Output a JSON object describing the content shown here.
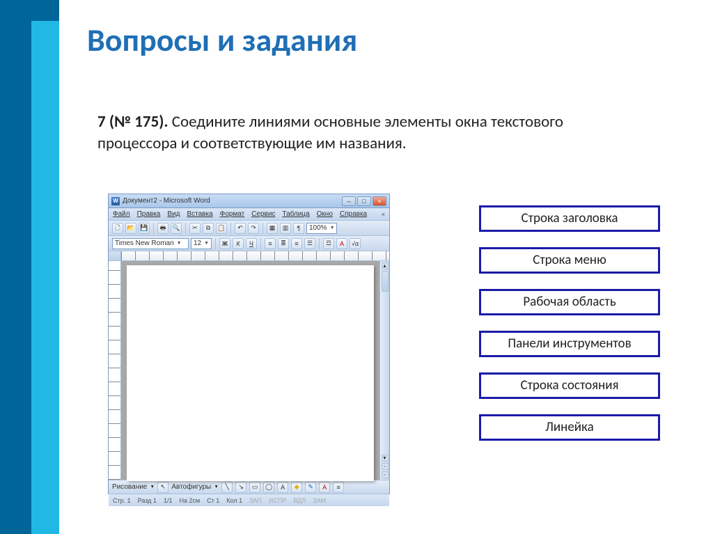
{
  "slide": {
    "title": "Вопросы и задания",
    "question_num": "7 (№ 175).",
    "question_text": " Соедините линиями основные элементы окна текстового процессора и соответствующие им названия."
  },
  "word": {
    "title": "Документ2 - Microsoft Word",
    "menu": [
      "Файл",
      "Правка",
      "Вид",
      "Вставка",
      "Формат",
      "Сервис",
      "Таблица",
      "Окно",
      "Справка"
    ],
    "font_name": "Times New Roman",
    "font_size": "12",
    "bold": "Ж",
    "italic": "К",
    "underline": "Ч",
    "zoom": "100%",
    "draw_label": "Рисование",
    "autoshapes": "Автофигуры",
    "status": {
      "page": "Стр. 1",
      "section": "Разд 1",
      "pages": "1/1",
      "at": "На 2см",
      "line": "Ст 1",
      "col": "Кол 1",
      "rec": "ЗАП",
      "trk": "ИСПР",
      "ext": "ВДЛ",
      "ovr": "ЗАМ"
    }
  },
  "answers": [
    "Строка заголовка",
    "Строка меню",
    "Рабочая область",
    "Панели инструментов",
    "Строка состояния",
    "Линейка"
  ],
  "colors": {
    "accent": "#1f6fb5",
    "sidedark": "#006599",
    "sidelight": "#22b8e6",
    "answer_border": "#1a1aa8"
  }
}
